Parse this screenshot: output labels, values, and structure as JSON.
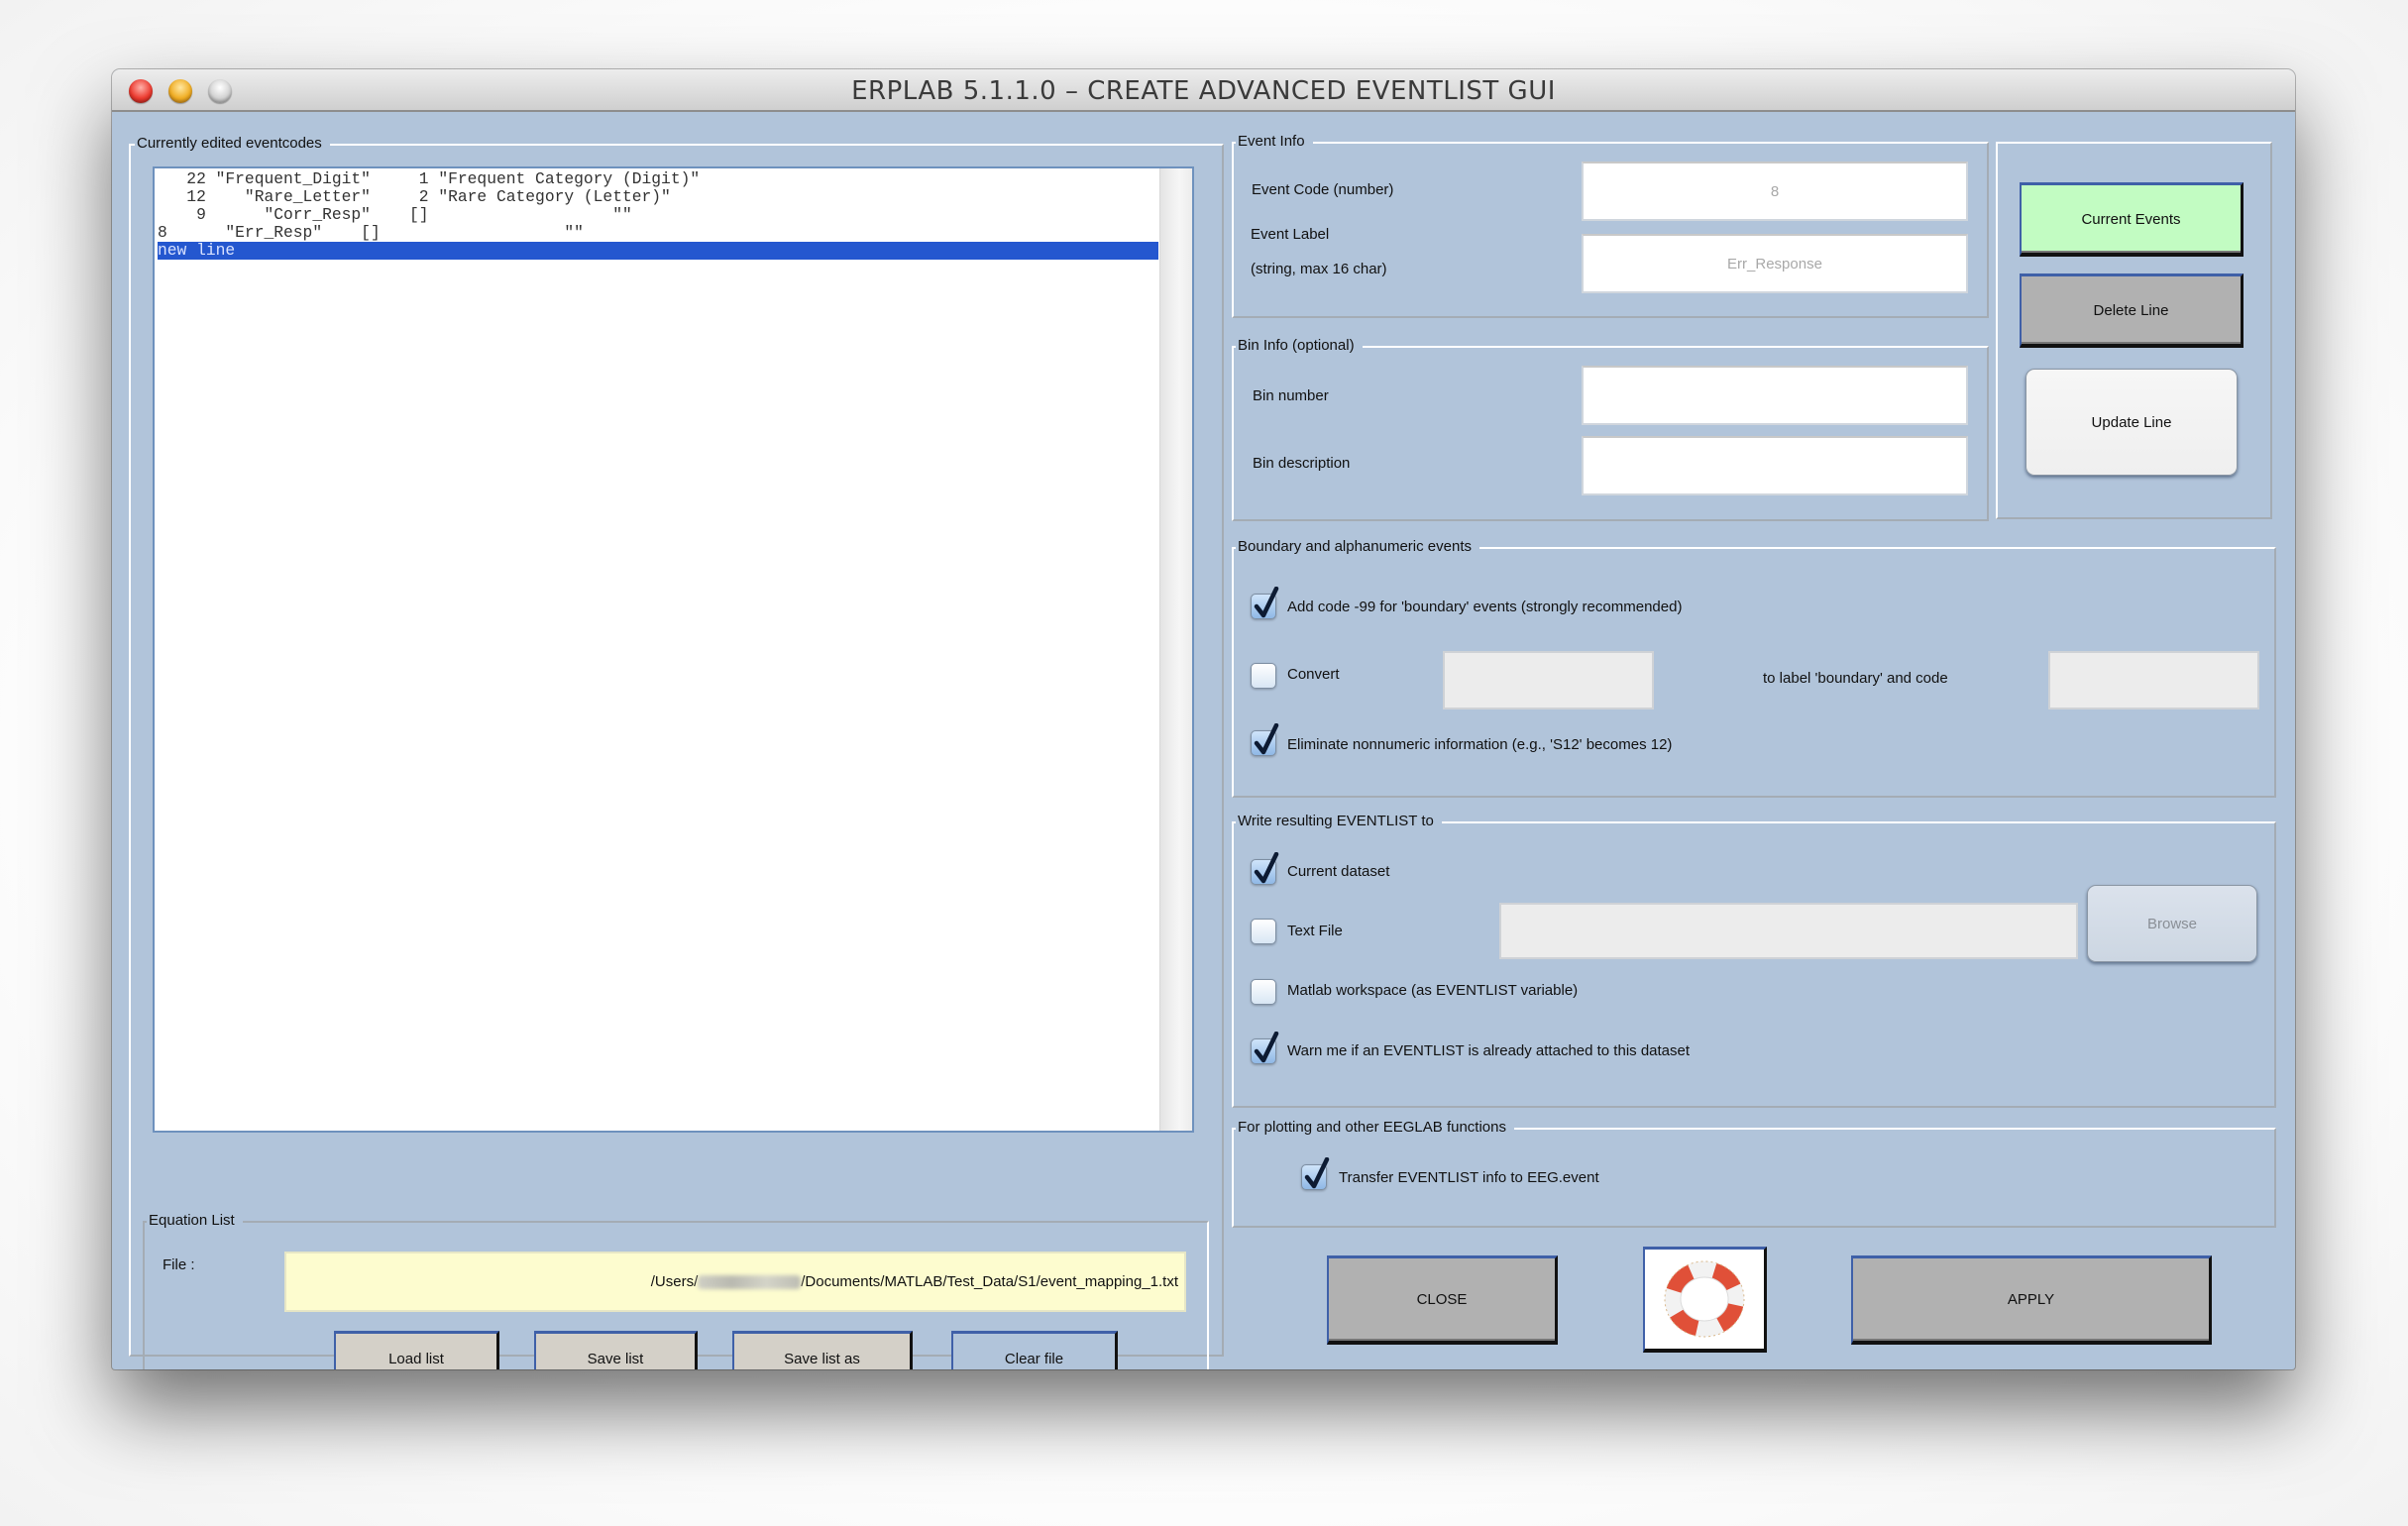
{
  "window": {
    "title": "ERPLAB 5.1.1.0   –   CREATE ADVANCED EVENTLIST GUI",
    "controls": [
      "close",
      "minimize",
      "zoom"
    ]
  },
  "eventcodes_panel": {
    "title": "Currently edited eventcodes",
    "rows": [
      "   22 \"Frequent_Digit\"     1 \"Frequent Category (Digit)\"",
      "   12    \"Rare_Letter\"     2 \"Rare Category (Letter)\"",
      "    9      \"Corr_Resp\"    []                   \"\"",
      "8      \"Err_Resp\"    []                   \"\"",
      "new line"
    ],
    "selected_row_index": 4
  },
  "equation_list": {
    "title": "Equation List",
    "file_label": "File :",
    "file_path_prefix": "/Users/",
    "file_path_suffix": "/Documents/MATLAB/Test_Data/S1/event_mapping_1.txt",
    "buttons": {
      "load": "Load list",
      "save": "Save list",
      "save_as": "Save list as",
      "clear": "Clear file"
    }
  },
  "event_info": {
    "title": "Event Info",
    "code_label": "Event Code (number)",
    "code_value": "8",
    "label_label_line1": "Event Label",
    "label_label_line2": "(string, max 16 char)",
    "label_value": "Err_Response"
  },
  "bin_info": {
    "title": "Bin Info (optional)",
    "bin_number_label": "Bin number",
    "bin_number_value": "",
    "bin_description_label": "Bin description",
    "bin_description_value": ""
  },
  "side_buttons": {
    "current_events": "Current Events",
    "delete_line": "Delete Line",
    "update_line": "Update Line"
  },
  "boundary": {
    "title": "Boundary and alphanumeric events",
    "add_code_label": "Add code -99 for 'boundary'  events (strongly recommended)",
    "add_code_checked": true,
    "convert_label": "Convert",
    "convert_checked": false,
    "convert_from_value": "",
    "to_label": "to label 'boundary' and code",
    "convert_to_value": "",
    "eliminate_label": "Eliminate nonnumeric information (e.g., 'S12' becomes 12)",
    "eliminate_checked": true
  },
  "write_to": {
    "title": "Write resulting EVENTLIST to",
    "current_dataset_label": "Current dataset",
    "current_dataset_checked": true,
    "text_file_label": "Text File",
    "text_file_checked": false,
    "text_file_value": "",
    "browse_label": "Browse",
    "workspace_label": "Matlab workspace (as EVENTLIST variable)",
    "workspace_checked": false,
    "warn_label": "Warn me if an EVENTLIST is already attached to this dataset",
    "warn_checked": true
  },
  "plotting": {
    "title": "For plotting and other EEGLAB functions",
    "transfer_label": "Transfer EVENTLIST info to EEG.event",
    "transfer_checked": true
  },
  "footer": {
    "close_label": "CLOSE",
    "help_icon": "life-ring-icon",
    "apply_label": "APPLY"
  },
  "colors": {
    "window_bg": "#b1c4da",
    "current_events_bg": "#c2fcc2",
    "gray_button_bg": "#b1b1b1",
    "equation_button_bg": "#d4d0c8",
    "clear_button_bg": "#b1c4da",
    "selection_bg": "#2457cf",
    "file_field_bg": "#fdfccf"
  }
}
